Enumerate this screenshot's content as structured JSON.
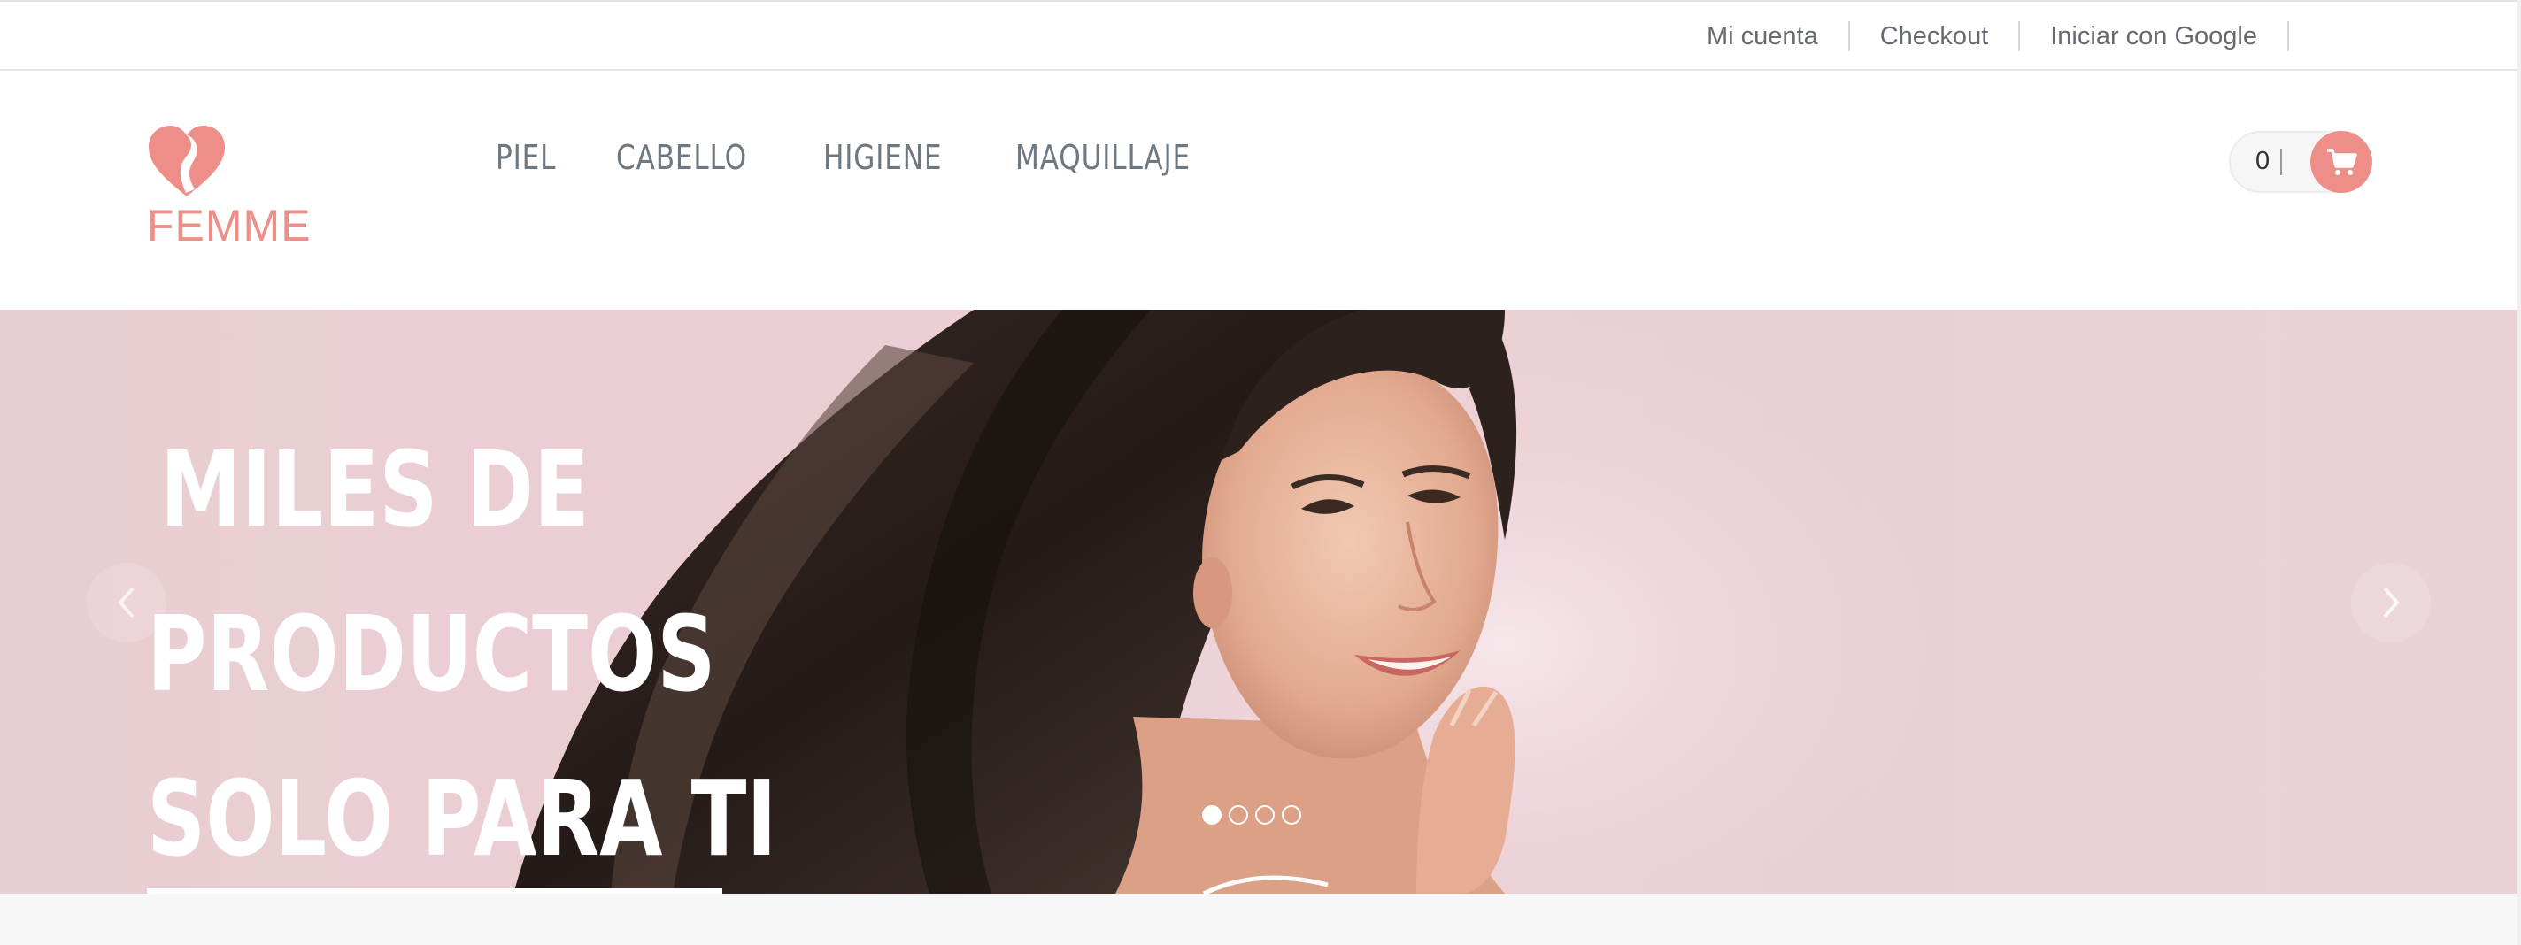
{
  "topbar": {
    "links": [
      "Mi cuenta",
      "Checkout",
      "Iniciar con Google"
    ]
  },
  "header": {
    "logo_text": "FEMME",
    "nav": [
      "PIEL",
      "CABELLO",
      "HIGIENE",
      "MAQUILLAJE"
    ],
    "cart_count": "0"
  },
  "hero": {
    "title_lines": [
      "MILES DE",
      "PRODUCTOS",
      "SOLO PARA TI"
    ],
    "slides_total": 4,
    "active_slide": 1
  },
  "colors": {
    "brand": "#ee8e88",
    "hero_background": "#eccfd4",
    "nav_text": "#6e7880"
  },
  "icons": {
    "logo": "heart-woman-icon",
    "cart": "shopping-cart-icon",
    "prev": "chevron-left-icon",
    "next": "chevron-right-icon"
  }
}
